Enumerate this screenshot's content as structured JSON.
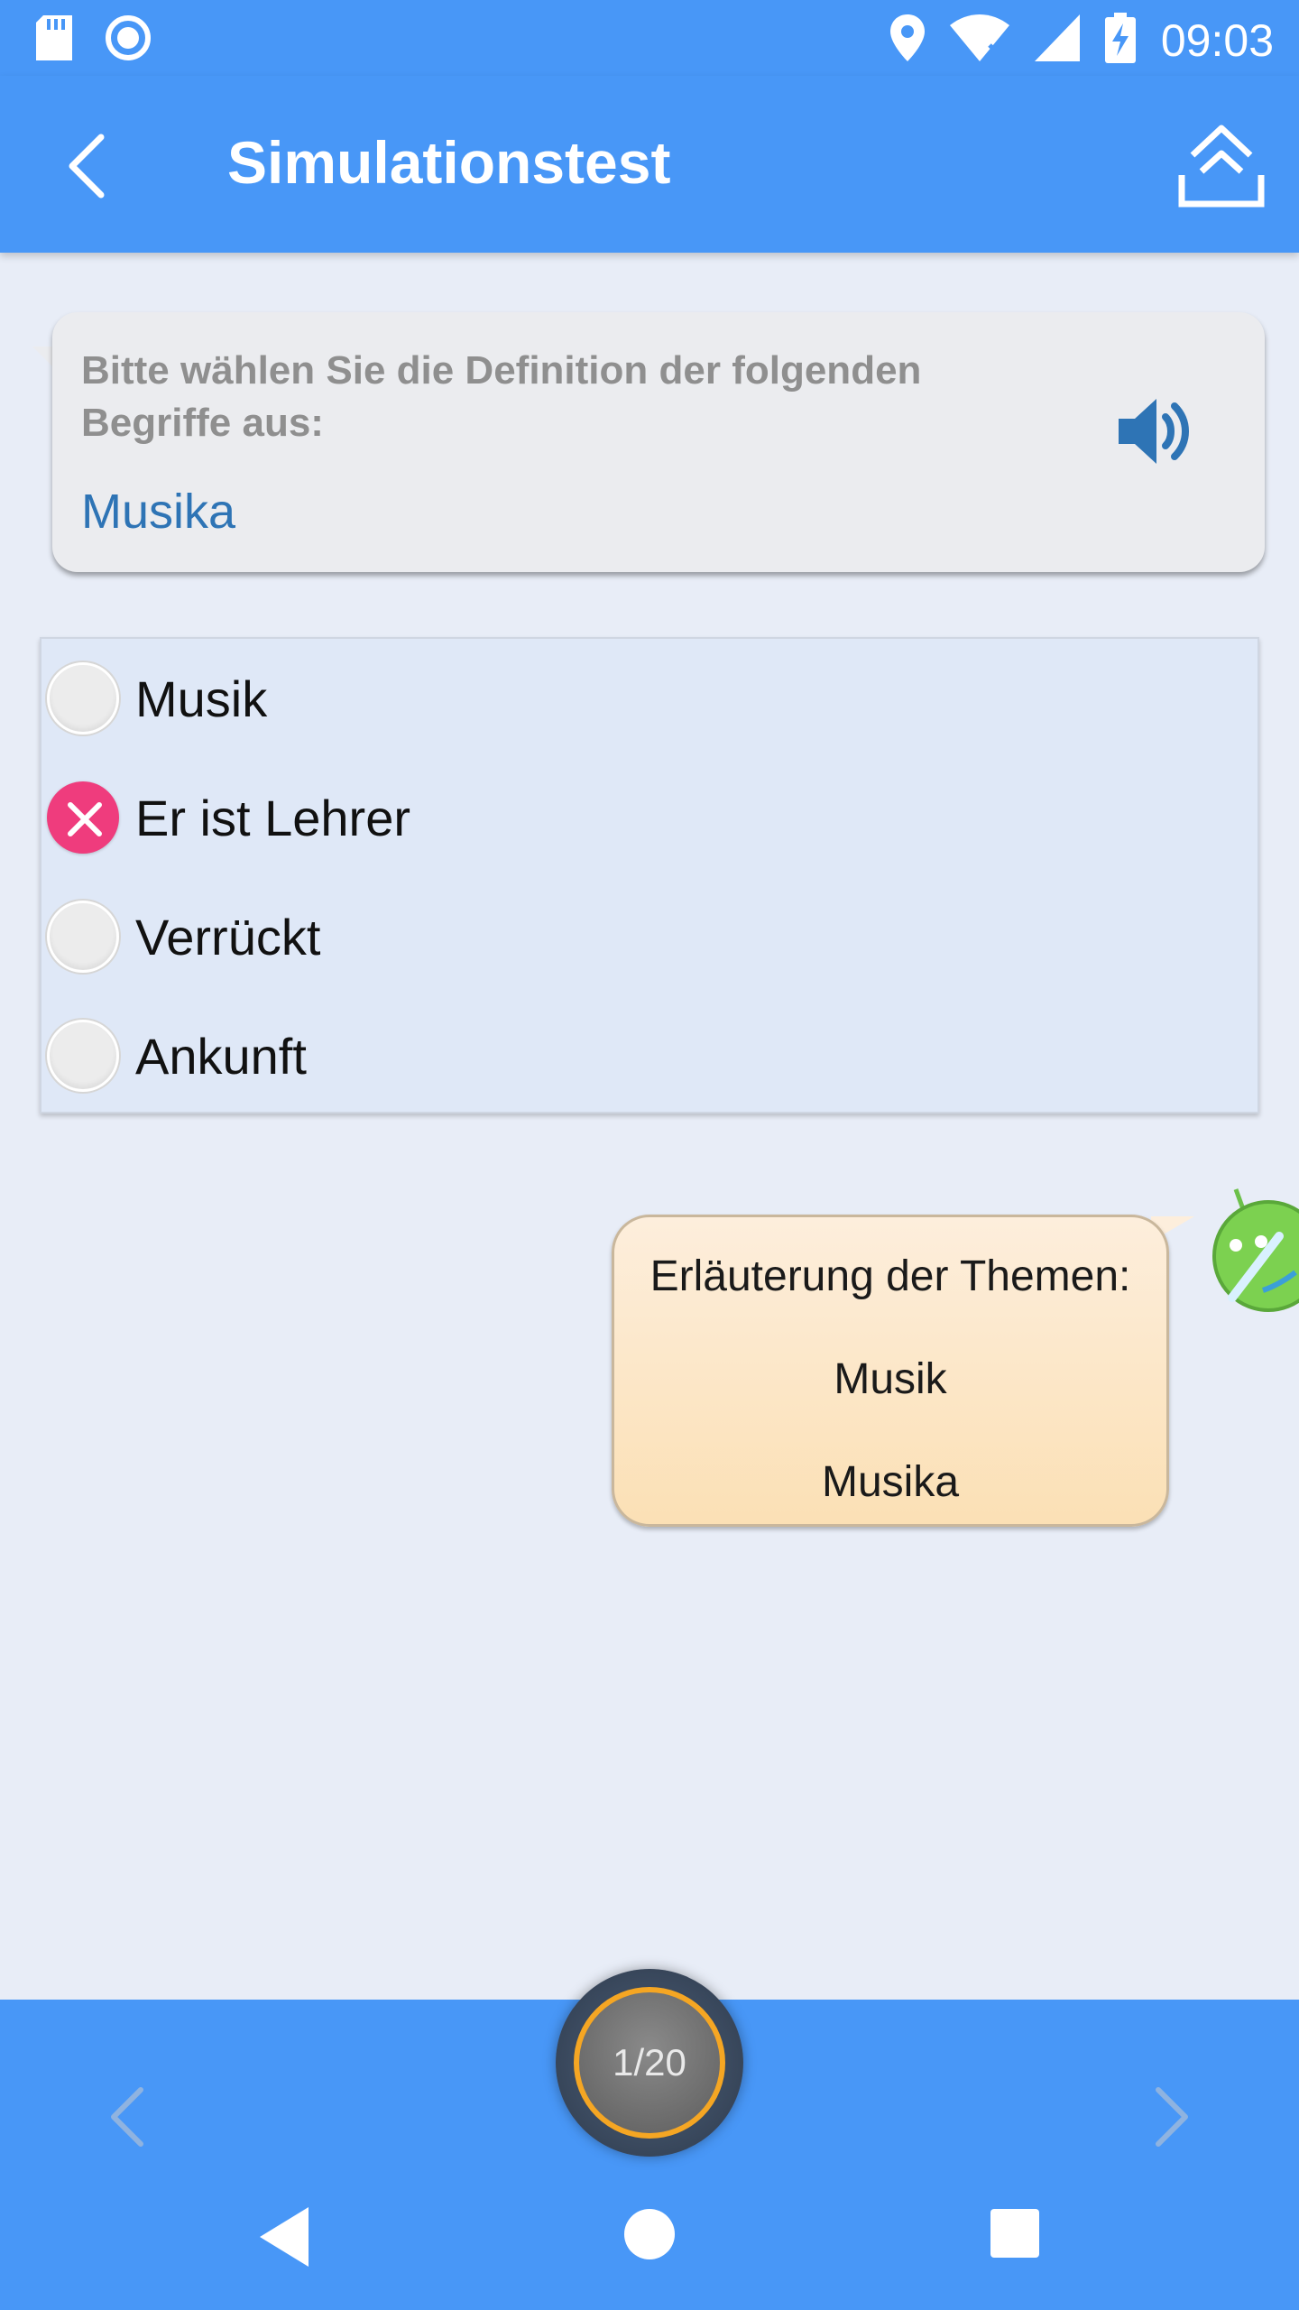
{
  "status_bar": {
    "time": "09:03",
    "left_icons": [
      "sd-card-icon",
      "record-icon"
    ],
    "right_icons": [
      "location-icon",
      "wifi-icon",
      "signal-icon",
      "battery-charging-icon"
    ]
  },
  "toolbar": {
    "title": "Simulationstest",
    "back_icon": "chevron-left-icon",
    "share_icon": "upload-icon"
  },
  "question": {
    "prompt": "Bitte wählen Sie die Definition der folgenden Begriffe aus:",
    "term": "Musika",
    "speaker_icon": "speaker-icon"
  },
  "options": [
    {
      "label": "Musik",
      "state": "unselected"
    },
    {
      "label": "Er ist Lehrer",
      "state": "wrong"
    },
    {
      "label": "Verrückt",
      "state": "unselected"
    },
    {
      "label": "Ankunft",
      "state": "unselected"
    }
  ],
  "explanation": {
    "heading": "Erläuterung der Themen:",
    "answer": "Musik",
    "term": "Musika"
  },
  "footer": {
    "counter": "1/20",
    "prev_icon": "chevron-left-icon",
    "next_icon": "chevron-right-icon"
  },
  "colors": {
    "primary": "#4897f7",
    "accent_term": "#2e74b5",
    "wrong": "#ef3c7d",
    "ring": "#f5a623"
  }
}
